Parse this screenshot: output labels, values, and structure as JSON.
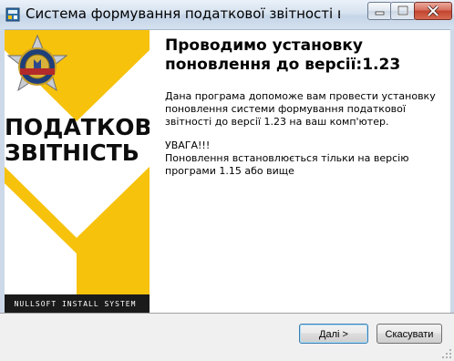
{
  "window": {
    "title": "Система формування податкової звітності версія ...",
    "buttons": {
      "minimize": "minimize",
      "maximize": "maximize",
      "close": "close"
    }
  },
  "banner": {
    "word_1": "ПОДАТКОВА",
    "word_2": "ЗВІТНІСТЬ",
    "footer": "NULLSOFT INSTALL SYSTEM",
    "emblem_text": "ДЕРЖАВНА ПОДАТКОВА АДМІНІСТРАЦІЯ УКРАЇНИ",
    "colors": {
      "yellow": "#f6c20c",
      "white": "#ffffff",
      "footer_bg": "#1a1a1a"
    }
  },
  "content": {
    "heading": "Проводимо установку поновлення до версії:1.23",
    "paragraph_1": "Дана програма допоможе вам провести установку поновлення системи формування податкової звітності до версії 1.23 на ваш комп'ютер.",
    "warning_title": "УВАГА!!!",
    "warning_text": "Поновлення встановлюється тільки на версію програми 1.15 або вище"
  },
  "footer": {
    "next_label": "Далі >",
    "cancel_label": "Скасувати"
  }
}
